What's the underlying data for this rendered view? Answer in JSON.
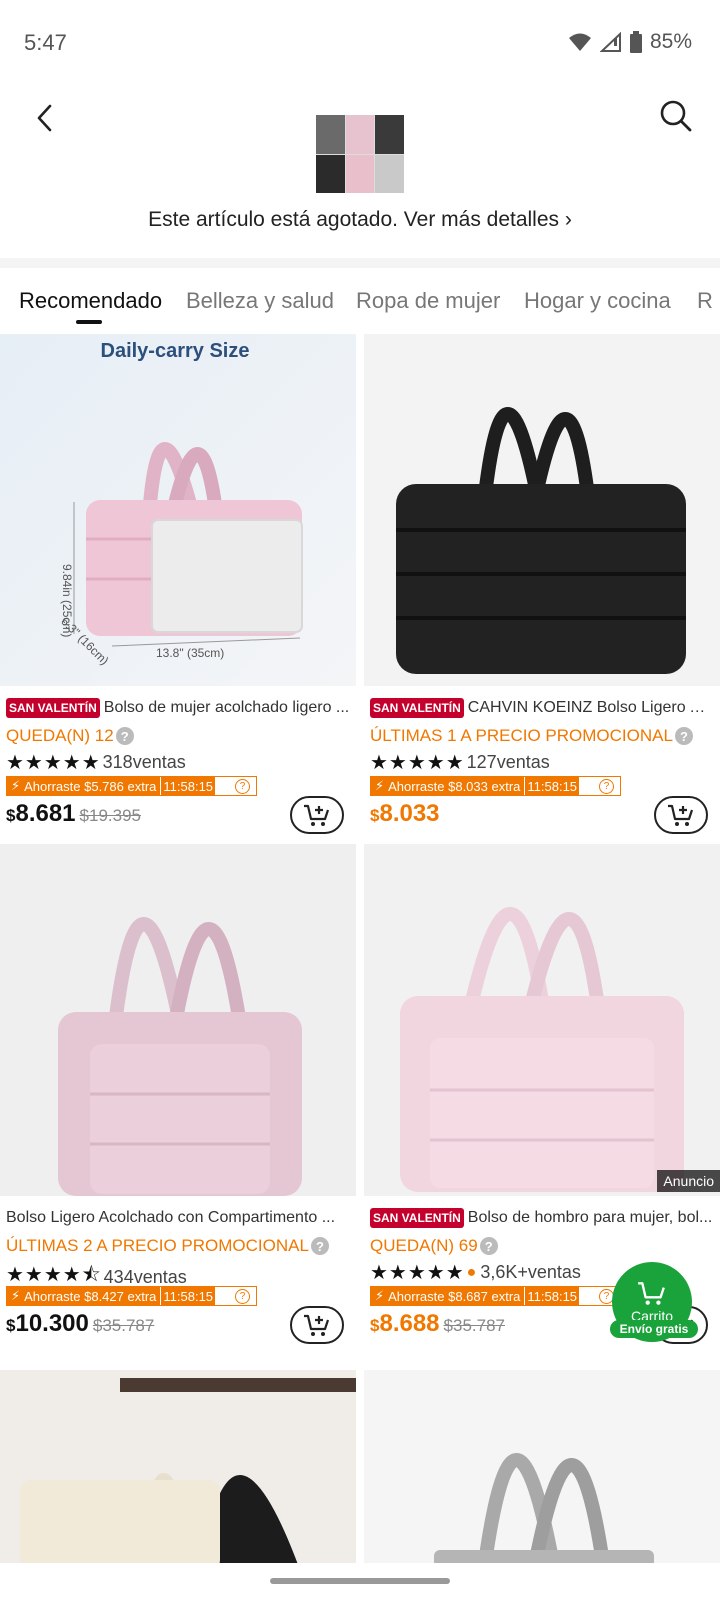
{
  "status_bar": {
    "time": "5:47",
    "battery": "85%"
  },
  "header": {
    "oos_notice": "Este artículo está agotado. Ver más detalles ›"
  },
  "tabs": [
    "Recomendado",
    "Belleza y salud",
    "Ropa de mujer",
    "Hogar y cocina",
    "R"
  ],
  "products": [
    {
      "image_text": "Daily-carry Size",
      "dim_height": "9.84in (25cm)",
      "dim_depth": "6.3\" (16cm)",
      "dim_width": "13.8\" (35cm)",
      "badge": "SAN VALENTÍN",
      "title": "Bolso de mujer acolchado ligero ...",
      "stock": "QUEDA(N) 12",
      "rating": 5,
      "sales": "318ventas",
      "saving": "Ahorraste $5.786 extra",
      "timer": "11:58:15",
      "price": "8.681",
      "old_price": "$19.395"
    },
    {
      "badge": "SAN VALENTÍN",
      "title": "CAHVIN KOEINZ Bolso Ligero Ac...",
      "stock": "ÚLTIMAS 1 A PRECIO PROMOCIONAL",
      "rating": 5,
      "sales": "127ventas",
      "saving": "Ahorraste $8.033 extra",
      "timer": "11:58:15",
      "price": "8.033",
      "old_price": ""
    },
    {
      "badge": "",
      "title": "Bolso Ligero Acolchado con Compartimento ...",
      "stock": "ÚLTIMAS 2 A PRECIO PROMOCIONAL",
      "rating": 4.5,
      "sales": "434ventas",
      "saving": "Ahorraste $8.427 extra",
      "timer": "11:58:15",
      "price": "10.300",
      "old_price": "$35.787"
    },
    {
      "ad_label": "Anuncio",
      "badge": "SAN VALENTÍN",
      "title": "Bolso de hombro para mujer, bol...",
      "stock": "QUEDA(N) 69",
      "rating": 5,
      "sales": "3,6K+ventas",
      "saving": "Ahorraste $8.687 extra",
      "timer": "11:58:15",
      "price": "8.688",
      "old_price": "$35.787"
    }
  ],
  "floating_cart": {
    "label": "Carrito",
    "shipping": "Envío gratis"
  },
  "colors": {
    "accent_orange": "#f07800",
    "badge_red": "#c4002c",
    "cart_green": "#1aa33a"
  },
  "icons": [
    "back-arrow-icon",
    "search-icon",
    "add-to-cart-icon",
    "star-icon",
    "fire-icon",
    "lightning-icon",
    "question-icon",
    "wifi-icon",
    "signal-icon",
    "battery-icon"
  ]
}
